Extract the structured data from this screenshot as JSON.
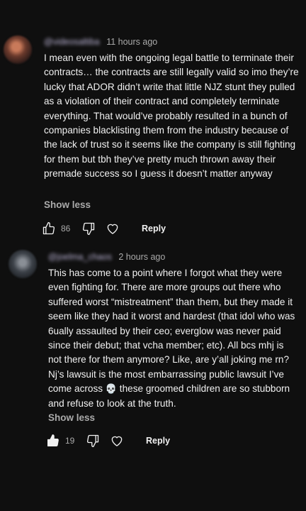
{
  "comments": [
    {
      "author": "@videosaltiba",
      "time": "11 hours ago",
      "text": "I mean even with the ongoing legal battle to terminate their contracts… the contracts are still legally valid so imo they’re lucky that ADOR didn’t write that little NJZ stunt they pulled as a violation of their contract and completely terminate everything. That would’ve probably resulted in a bunch of companies blacklisting them from the industry because of the lack of trust so it seems like the company is still fighting for them but tbh they’ve pretty much thrown away their premade success so I guess it doesn’t matter anyway",
      "show_less": "Show less",
      "likes": "86",
      "reply": "Reply",
      "liked": false
    },
    {
      "author": "@joelma_chaos",
      "time": "2 hours ago",
      "text_before": "This has come to a point where I forgot what they were even fighting for. There are more groups out there who suffered worst “mistreatment” than them, but they made it seem like they had it worst and hardest (that idol who was 6ually assaulted by their ceo; everglow was never paid since their debut; that vcha member; etc). All bcs mhj is not there for them anymore? Like, are y’all joking me rn? Nj’s lawsuit is the most embarrassing public lawsuit I’ve come across ",
      "emoji": "💀",
      "text_after": " these groomed children are so stubborn and refuse to look at the truth.",
      "show_less": "Show less",
      "likes": "19",
      "reply": "Reply",
      "liked": true
    }
  ],
  "icons": {
    "like": "thumbs-up-icon",
    "dislike": "thumbs-down-icon",
    "heart": "heart-icon",
    "emoji": "skull-emoji"
  },
  "colors": {
    "background": "#0f0f0f",
    "text": "#f1f1f1",
    "secondary": "#aaaaaa"
  }
}
